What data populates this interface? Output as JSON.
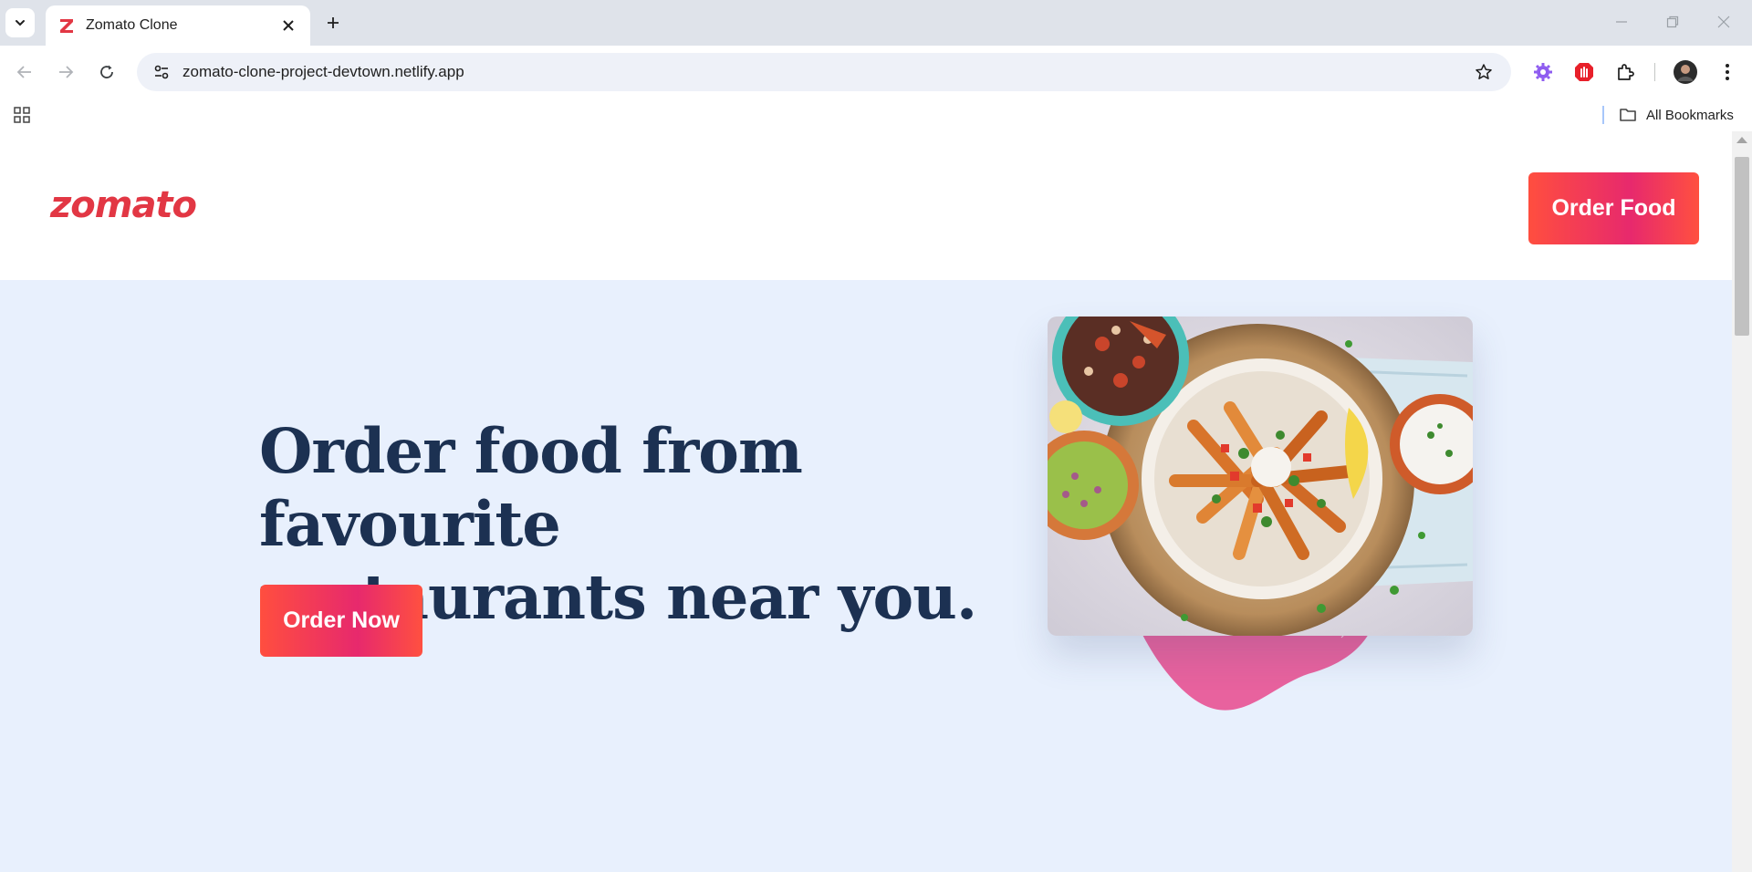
{
  "browser": {
    "tab": {
      "title": "Zomato Clone",
      "favicon_letter": "Z"
    },
    "address": {
      "url": "zomato-clone-project-devtown.netlify.app"
    },
    "bookmarks": {
      "all_label": "All Bookmarks"
    }
  },
  "site": {
    "logo": "zomato",
    "header_cta": "Order Food",
    "hero": {
      "headline_line1": "Order food from favourite",
      "headline_line2": "restaurants near you.",
      "cta": "Order Now"
    }
  },
  "colors": {
    "brand_red": "#e23744",
    "heading_navy": "#1c3152",
    "hero_bg": "#e8f0fd",
    "button_gradient_start": "#ff4e3f",
    "button_gradient_mid": "#e7296d",
    "blob_pink": "#e8629e"
  },
  "icons": [
    "tab-search-icon",
    "close-icon",
    "plus-icon",
    "minimize-icon",
    "restore-icon",
    "window-close-icon",
    "back-arrow-icon",
    "forward-arrow-icon",
    "reload-icon",
    "site-info-icon",
    "bookmark-star-icon",
    "extension-gear-icon",
    "extension-red-icon",
    "puzzle-icon",
    "avatar",
    "more-vert-icon",
    "apps-grid-icon",
    "folder-icon"
  ]
}
